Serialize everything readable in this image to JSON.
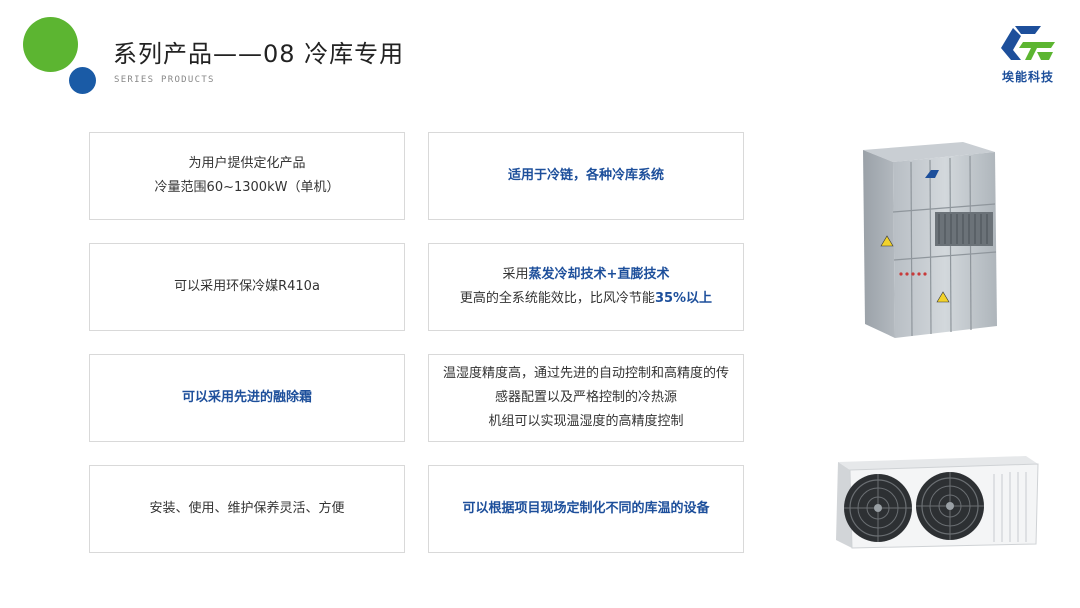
{
  "header": {
    "title": "系列产品——08  冷库专用",
    "subtitle": "SERIES PRODUCTS"
  },
  "logo": {
    "name": "埃能科技",
    "icon": "company-logo-icon"
  },
  "colors": {
    "green": "#5cb531",
    "blue": "#1a5ba6",
    "accent_text": "#1d4f9b"
  },
  "cards": {
    "c1": {
      "line1": "为用户提供定化产品",
      "line2": "冷量范围60~1300kW（单机）"
    },
    "c2": {
      "line1": "适用于冷链，各种冷库系统"
    },
    "c3": {
      "line1": "可以采用环保冷媒R410a"
    },
    "c4": {
      "prefix": "采用",
      "highlight1": "蒸发冷却技术+直膨技术",
      "line2_prefix": "更高的全系统能效比，比风冷节能",
      "highlight2": "35%以上"
    },
    "c5": {
      "line1": "可以采用先进的融除霜"
    },
    "c6": {
      "line1": "温湿度精度高，通过先进的自动控制和高精度的传",
      "line2": "感器配置以及严格控制的冷热源",
      "line3": "机组可以实现温湿度的高精度控制"
    },
    "c7": {
      "line1": "安装、使用、维护保养灵活、方便"
    },
    "c8": {
      "line1": "可以根据项目现场定制化不同的库温的设备"
    }
  },
  "images": {
    "product1": "evaporative-condenser-unit-image",
    "product2": "cold-room-evaporator-fan-unit-image"
  }
}
